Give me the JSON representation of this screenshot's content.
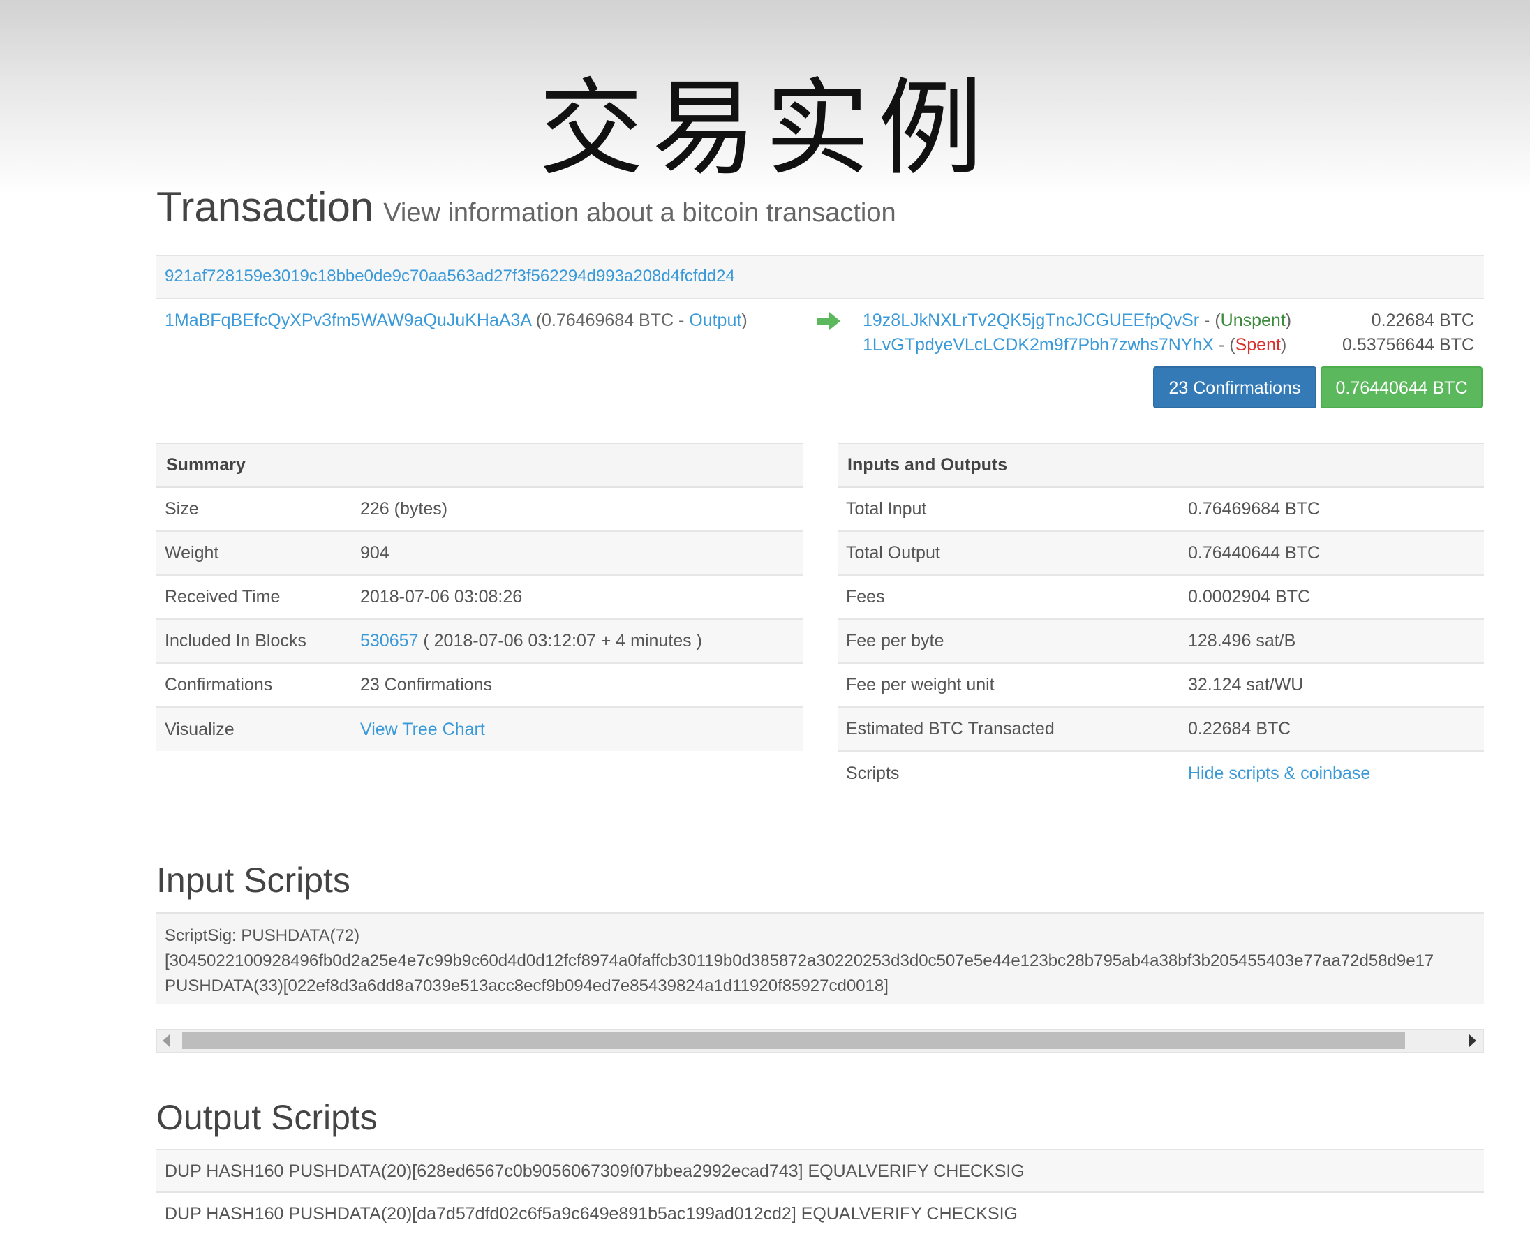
{
  "banner": "交易实例",
  "header": {
    "title": "Transaction",
    "subtitle": "View information about a bitcoin transaction"
  },
  "tx": {
    "hash": "921af728159e3019c18bbe0de9c70aa563ad27f3f562294d993a208d4fcfdd24",
    "input": {
      "address": "1MaBFqBEfcQyXPv3fm5WAW9aQuJuKHaA3A",
      "open": "(0.76469684 BTC - ",
      "output_link": "Output",
      "close": ")"
    },
    "outputs": [
      {
        "address": "19z8LJkNXLrTv2QK5jgTncJCGUEEfpQvSr",
        "sep": " - (",
        "status": "Unspent",
        "close": ")",
        "amount": "0.22684 BTC"
      },
      {
        "address": "1LvGTpdyeVLcLCDK2m9f7Pbh7zwhs7NYhX",
        "sep": " - (",
        "status": "Spent",
        "close": ")",
        "amount": "0.53756644 BTC"
      }
    ],
    "confirmations_button": "23 Confirmations",
    "total_button": "0.76440644 BTC",
    "colors": {
      "arrow": "#5cb85c",
      "link": "#3a9ad9",
      "unspent": "#3d8b3d",
      "spent": "#d9302c"
    }
  },
  "summary": {
    "heading": "Summary",
    "rows": [
      {
        "key": "Size",
        "value": "226 (bytes)"
      },
      {
        "key": "Weight",
        "value": "904"
      },
      {
        "key": "Received Time",
        "value": "2018-07-06 03:08:26"
      },
      {
        "key": "Included In Blocks",
        "block_link": "530657",
        "value_rest": " ( 2018-07-06 03:12:07 + 4 minutes )"
      },
      {
        "key": "Confirmations",
        "value": "23 Confirmations"
      },
      {
        "key": "Visualize",
        "link": "View Tree Chart"
      }
    ]
  },
  "io": {
    "heading": "Inputs and Outputs",
    "rows": [
      {
        "key": "Total Input",
        "value": "0.76469684 BTC"
      },
      {
        "key": "Total Output",
        "value": "0.76440644 BTC"
      },
      {
        "key": "Fees",
        "value": "0.0002904 BTC"
      },
      {
        "key": "Fee per byte",
        "value": "128.496 sat/B"
      },
      {
        "key": "Fee per weight unit",
        "value": "32.124 sat/WU"
      },
      {
        "key": "Estimated BTC Transacted",
        "value": "0.22684 BTC"
      },
      {
        "key": "Scripts",
        "link": "Hide scripts & coinbase"
      }
    ]
  },
  "input_scripts": {
    "title": "Input Scripts",
    "lines": [
      "ScriptSig: PUSHDATA(72)",
      "[3045022100928496fb0d2a25e4e7c99b9c60d4d0d12fcf8974a0faffcb30119b0d385872a30220253d3d0c507e5e44e123bc28b795ab4a38bf3b205455403e77aa72d58d9e17",
      "PUSHDATA(33)[022ef8d3a6dd8a7039e513acc8ecf9b094ed7e85439824a1d11920f85927cd0018]"
    ]
  },
  "output_scripts": {
    "title": "Output Scripts",
    "lines": [
      "DUP HASH160 PUSHDATA(20)[628ed6567c0b9056067309f07bbea2992ecad743] EQUALVERIFY CHECKSIG",
      "DUP HASH160 PUSHDATA(20)[da7d57dfd02c6f5a9c649e891b5ac199ad012cd2] EQUALVERIFY CHECKSIG"
    ]
  }
}
